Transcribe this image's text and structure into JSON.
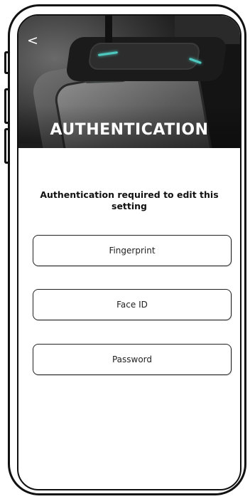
{
  "header": {
    "back_label": "<",
    "title": "AUTHENTICATION"
  },
  "main": {
    "prompt": "Authentication required to edit this setting",
    "options": [
      {
        "label": "Fingerprint"
      },
      {
        "label": "Face ID"
      },
      {
        "label": "Password"
      }
    ]
  },
  "colors": {
    "accent": "#4ec9c0",
    "text": "#111111",
    "header_overlay_text": "#ffffff"
  },
  "icons": {
    "back": "chevron-left-icon"
  }
}
